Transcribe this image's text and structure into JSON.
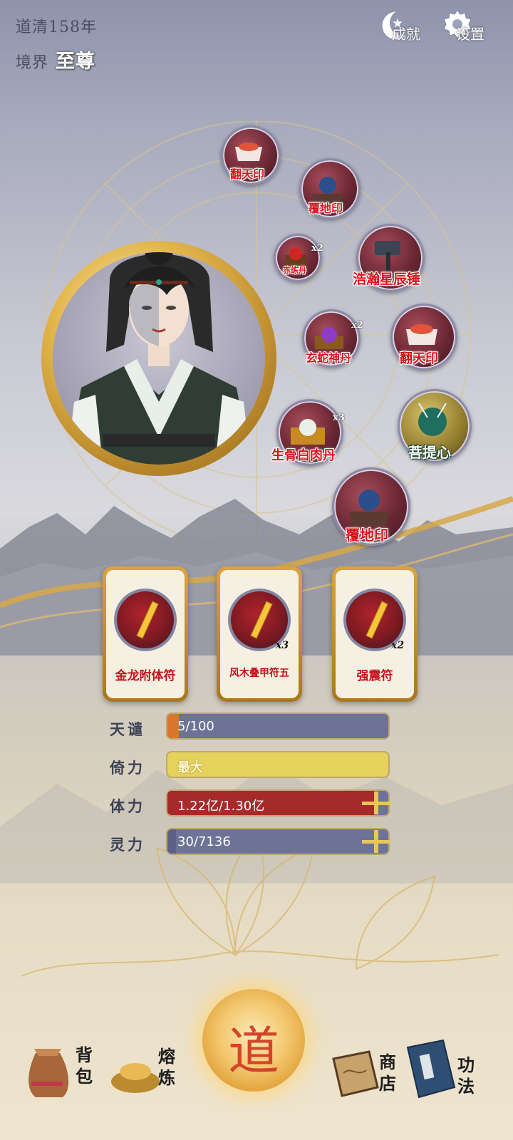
{
  "header": {
    "year_text": "道清158年",
    "realm_label": "境界",
    "realm_value": "至尊"
  },
  "top_buttons": {
    "achievement_label": "成就",
    "settings_label": "设置"
  },
  "treasures": [
    {
      "label": "翻天印",
      "count": ""
    },
    {
      "label": "覆地印",
      "count": ""
    },
    {
      "label": "赤练丹",
      "count": "x2"
    },
    {
      "label": "浩瀚星辰锤",
      "count": ""
    },
    {
      "label": "玄蛇神丹",
      "count": "x2"
    },
    {
      "label": "翻天印",
      "count": ""
    },
    {
      "label": "生骨白肉丹",
      "count": "x3"
    },
    {
      "label": "菩提心",
      "count": ""
    },
    {
      "label": "覆地印",
      "count": ""
    }
  ],
  "talismans": [
    {
      "name": "金龙附体符",
      "count": ""
    },
    {
      "name": "风木叠甲符五",
      "count": "x3"
    },
    {
      "name": "强震符",
      "count": "x2"
    }
  ],
  "stats": {
    "tianqian": {
      "label": "天谴",
      "value": "5/100",
      "fraction": 0.05
    },
    "jiuli": {
      "label": "倚力",
      "value": "最大",
      "fraction": 1.0
    },
    "tili": {
      "label": "体力",
      "value": "1.22亿/1.30亿",
      "fraction": 0.94
    },
    "lingli": {
      "label": "灵力",
      "value": "30/7136",
      "fraction": 0.004
    }
  },
  "nav": {
    "bag_label": "背包",
    "refine_label": "熔炼",
    "dao_label": "道",
    "shop_label": "商店",
    "skills_label": "功法"
  },
  "colors": {
    "treasure_label": "#d9131b",
    "stamina_bar": "#a62a2a",
    "might_bar": "#e6d25a",
    "default_bar": "#6d7396",
    "gold": "#d9a441"
  }
}
